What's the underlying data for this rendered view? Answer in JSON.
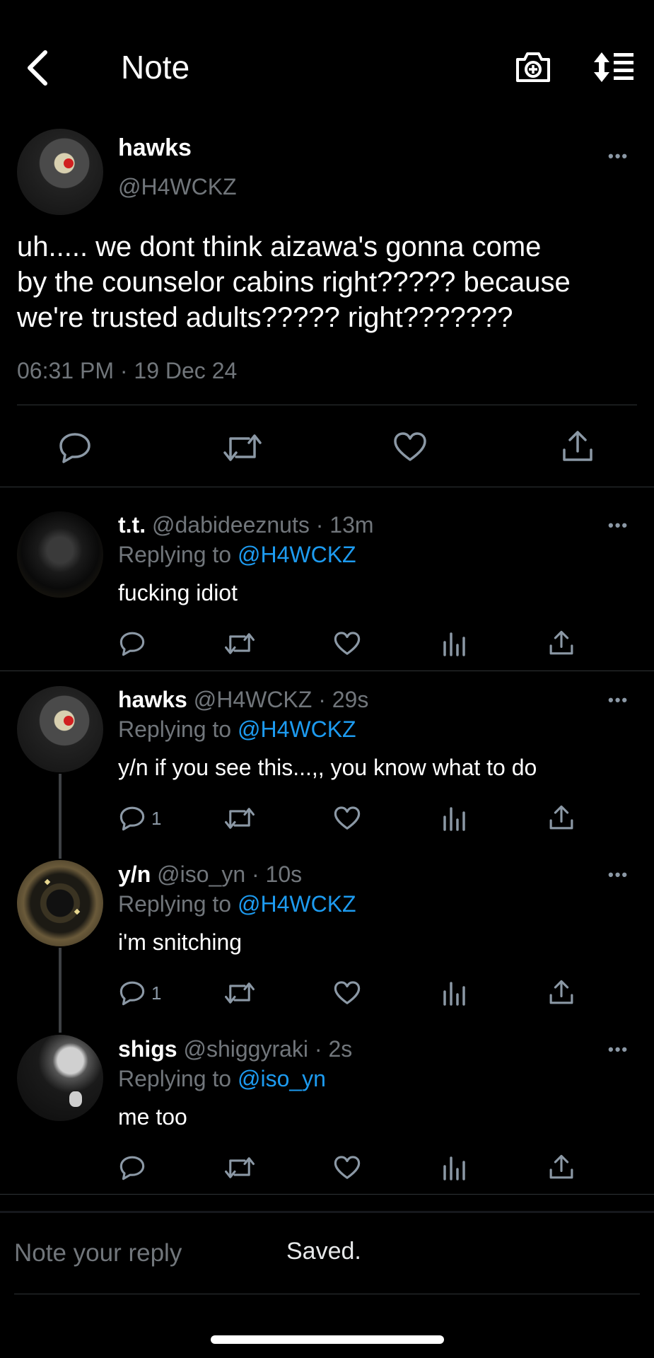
{
  "header": {
    "title": "Note"
  },
  "main_tweet": {
    "name": "hawks",
    "handle": "@H4WCKZ",
    "text_lines": [
      "uh..... we dont think aizawa's gonna come",
      "by the counselor cabins right????? because",
      "we're trusted adults????? right???????"
    ],
    "timestamp": "06:31 PM · 19 Dec 24"
  },
  "replies": [
    {
      "name": "t.t.",
      "meta": "@dabideeznuts · 13m",
      "replying_prefix": "Replying to",
      "replying_to": "@H4WCKZ",
      "text": "fucking idiot",
      "reply_count": ""
    },
    {
      "name": "hawks",
      "meta": "@H4WCKZ · 29s",
      "replying_prefix": "Replying to",
      "replying_to": "@H4WCKZ",
      "text": "y/n if you see this...,, you know what to do",
      "reply_count": "1"
    },
    {
      "name": "y/n",
      "meta": "@iso_yn · 10s",
      "replying_prefix": "Replying to",
      "replying_to": "@H4WCKZ",
      "text": "i'm snitching",
      "reply_count": "1"
    },
    {
      "name": "shigs",
      "meta": "@shiggyraki · 2s",
      "replying_prefix": "Replying to",
      "replying_to": "@iso_yn",
      "text": "me too",
      "reply_count": ""
    }
  ],
  "composer": {
    "placeholder": "Note your reply",
    "status": "Saved."
  },
  "colors": {
    "background": "#000000",
    "muted": "#71767b",
    "link": "#1d9bf0",
    "divider": "#2f3336"
  }
}
